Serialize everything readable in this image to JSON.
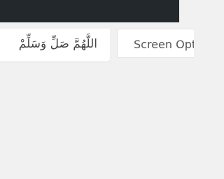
{
  "colors": {
    "admin_bar": "#23282d",
    "page_background": "#f1f1f1",
    "tab_background": "#ffffff",
    "text": "#444444"
  },
  "notice": {
    "arabic_text": "اللَّهُمَّ صَلِّ وَسَلِّمْ"
  },
  "screen_options": {
    "label": "Screen Options"
  }
}
